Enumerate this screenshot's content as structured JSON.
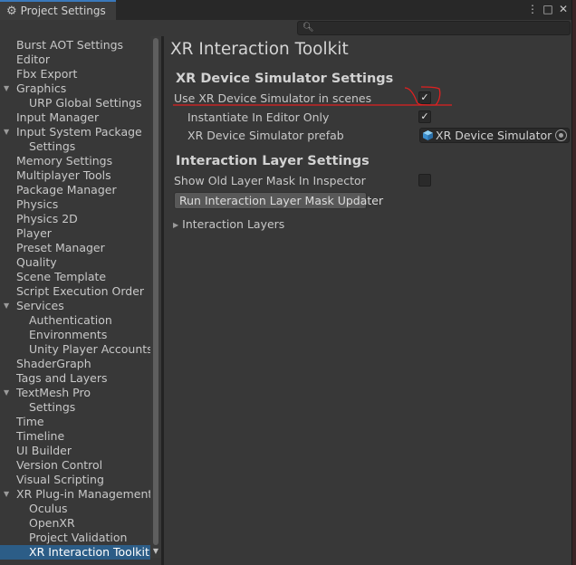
{
  "window": {
    "title": "Project Settings",
    "controls": [
      "⋮",
      "□",
      "✕"
    ]
  },
  "search": {
    "placeholder": "",
    "value": ""
  },
  "sidebar": {
    "items": [
      {
        "label": "Burst AOT Settings",
        "indent": 0,
        "expandable": false,
        "selected": false
      },
      {
        "label": "Editor",
        "indent": 0,
        "expandable": false,
        "selected": false
      },
      {
        "label": "Fbx Export",
        "indent": 0,
        "expandable": false,
        "selected": false
      },
      {
        "label": "Graphics",
        "indent": 0,
        "expandable": true,
        "selected": false
      },
      {
        "label": "URP Global Settings",
        "indent": 1,
        "expandable": false,
        "selected": false
      },
      {
        "label": "Input Manager",
        "indent": 0,
        "expandable": false,
        "selected": false
      },
      {
        "label": "Input System Package",
        "indent": 0,
        "expandable": true,
        "selected": false
      },
      {
        "label": "Settings",
        "indent": 1,
        "expandable": false,
        "selected": false
      },
      {
        "label": "Memory Settings",
        "indent": 0,
        "expandable": false,
        "selected": false
      },
      {
        "label": "Multiplayer Tools",
        "indent": 0,
        "expandable": false,
        "selected": false
      },
      {
        "label": "Package Manager",
        "indent": 0,
        "expandable": false,
        "selected": false
      },
      {
        "label": "Physics",
        "indent": 0,
        "expandable": false,
        "selected": false
      },
      {
        "label": "Physics 2D",
        "indent": 0,
        "expandable": false,
        "selected": false
      },
      {
        "label": "Player",
        "indent": 0,
        "expandable": false,
        "selected": false
      },
      {
        "label": "Preset Manager",
        "indent": 0,
        "expandable": false,
        "selected": false
      },
      {
        "label": "Quality",
        "indent": 0,
        "expandable": false,
        "selected": false
      },
      {
        "label": "Scene Template",
        "indent": 0,
        "expandable": false,
        "selected": false
      },
      {
        "label": "Script Execution Order",
        "indent": 0,
        "expandable": false,
        "selected": false
      },
      {
        "label": "Services",
        "indent": 0,
        "expandable": true,
        "selected": false
      },
      {
        "label": "Authentication",
        "indent": 1,
        "expandable": false,
        "selected": false
      },
      {
        "label": "Environments",
        "indent": 1,
        "expandable": false,
        "selected": false
      },
      {
        "label": "Unity Player Accounts",
        "indent": 1,
        "expandable": false,
        "selected": false
      },
      {
        "label": "ShaderGraph",
        "indent": 0,
        "expandable": false,
        "selected": false
      },
      {
        "label": "Tags and Layers",
        "indent": 0,
        "expandable": false,
        "selected": false
      },
      {
        "label": "TextMesh Pro",
        "indent": 0,
        "expandable": true,
        "selected": false
      },
      {
        "label": "Settings",
        "indent": 1,
        "expandable": false,
        "selected": false
      },
      {
        "label": "Time",
        "indent": 0,
        "expandable": false,
        "selected": false
      },
      {
        "label": "Timeline",
        "indent": 0,
        "expandable": false,
        "selected": false
      },
      {
        "label": "UI Builder",
        "indent": 0,
        "expandable": false,
        "selected": false
      },
      {
        "label": "Version Control",
        "indent": 0,
        "expandable": false,
        "selected": false
      },
      {
        "label": "Visual Scripting",
        "indent": 0,
        "expandable": false,
        "selected": false
      },
      {
        "label": "XR Plug-in Management",
        "indent": 0,
        "expandable": true,
        "selected": false
      },
      {
        "label": "Oculus",
        "indent": 1,
        "expandable": false,
        "selected": false
      },
      {
        "label": "OpenXR",
        "indent": 1,
        "expandable": false,
        "selected": false
      },
      {
        "label": "Project Validation",
        "indent": 1,
        "expandable": false,
        "selected": false
      },
      {
        "label": "XR Interaction Toolkit",
        "indent": 1,
        "expandable": false,
        "selected": true
      }
    ]
  },
  "main": {
    "title": "XR Interaction Toolkit",
    "simulator_section": {
      "heading": "XR Device Simulator Settings",
      "use_simulator_label": "Use XR Device Simulator in scenes",
      "use_simulator_checked": true,
      "editor_only_label": "Instantiate In Editor Only",
      "editor_only_checked": true,
      "prefab_label": "XR Device Simulator prefab",
      "prefab_value": "XR Device Simulator"
    },
    "layer_section": {
      "heading": "Interaction Layer Settings",
      "show_old_mask_label": "Show Old Layer Mask In Inspector",
      "show_old_mask_checked": false,
      "updater_button": "Run Interaction Layer Mask Updater",
      "layers_foldout": "Interaction Layers"
    }
  },
  "colors": {
    "selection": "#2c5d87",
    "tab_accent": "#3a79bb",
    "annotation": "#e02020",
    "prefab_icon": "#4aa3df"
  }
}
